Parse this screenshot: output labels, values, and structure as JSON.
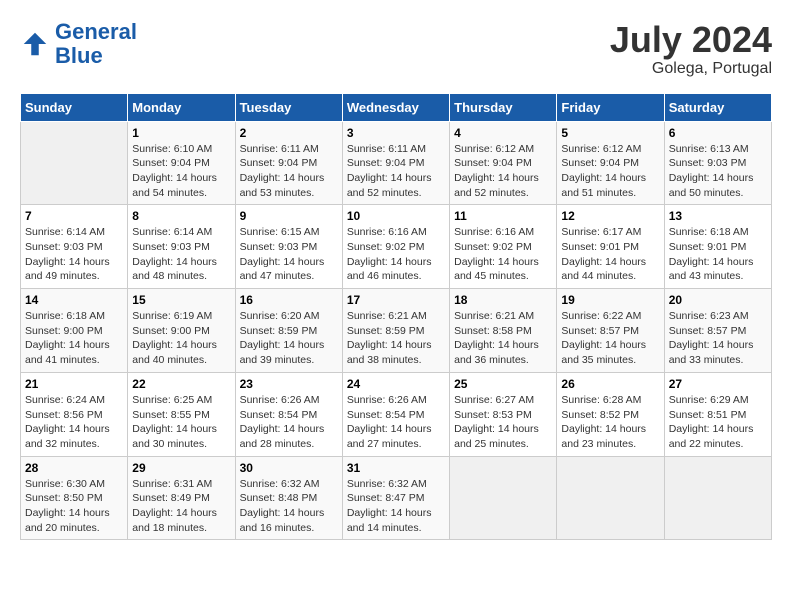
{
  "header": {
    "logo_line1": "General",
    "logo_line2": "Blue",
    "month": "July 2024",
    "location": "Golega, Portugal"
  },
  "days_of_week": [
    "Sunday",
    "Monday",
    "Tuesday",
    "Wednesday",
    "Thursday",
    "Friday",
    "Saturday"
  ],
  "weeks": [
    [
      {
        "day": "",
        "empty": true
      },
      {
        "day": "1",
        "sunrise": "Sunrise: 6:10 AM",
        "sunset": "Sunset: 9:04 PM",
        "daylight": "Daylight: 14 hours and 54 minutes."
      },
      {
        "day": "2",
        "sunrise": "Sunrise: 6:11 AM",
        "sunset": "Sunset: 9:04 PM",
        "daylight": "Daylight: 14 hours and 53 minutes."
      },
      {
        "day": "3",
        "sunrise": "Sunrise: 6:11 AM",
        "sunset": "Sunset: 9:04 PM",
        "daylight": "Daylight: 14 hours and 52 minutes."
      },
      {
        "day": "4",
        "sunrise": "Sunrise: 6:12 AM",
        "sunset": "Sunset: 9:04 PM",
        "daylight": "Daylight: 14 hours and 52 minutes."
      },
      {
        "day": "5",
        "sunrise": "Sunrise: 6:12 AM",
        "sunset": "Sunset: 9:04 PM",
        "daylight": "Daylight: 14 hours and 51 minutes."
      },
      {
        "day": "6",
        "sunrise": "Sunrise: 6:13 AM",
        "sunset": "Sunset: 9:03 PM",
        "daylight": "Daylight: 14 hours and 50 minutes."
      }
    ],
    [
      {
        "day": "7",
        "sunrise": "Sunrise: 6:14 AM",
        "sunset": "Sunset: 9:03 PM",
        "daylight": "Daylight: 14 hours and 49 minutes."
      },
      {
        "day": "8",
        "sunrise": "Sunrise: 6:14 AM",
        "sunset": "Sunset: 9:03 PM",
        "daylight": "Daylight: 14 hours and 48 minutes."
      },
      {
        "day": "9",
        "sunrise": "Sunrise: 6:15 AM",
        "sunset": "Sunset: 9:03 PM",
        "daylight": "Daylight: 14 hours and 47 minutes."
      },
      {
        "day": "10",
        "sunrise": "Sunrise: 6:16 AM",
        "sunset": "Sunset: 9:02 PM",
        "daylight": "Daylight: 14 hours and 46 minutes."
      },
      {
        "day": "11",
        "sunrise": "Sunrise: 6:16 AM",
        "sunset": "Sunset: 9:02 PM",
        "daylight": "Daylight: 14 hours and 45 minutes."
      },
      {
        "day": "12",
        "sunrise": "Sunrise: 6:17 AM",
        "sunset": "Sunset: 9:01 PM",
        "daylight": "Daylight: 14 hours and 44 minutes."
      },
      {
        "day": "13",
        "sunrise": "Sunrise: 6:18 AM",
        "sunset": "Sunset: 9:01 PM",
        "daylight": "Daylight: 14 hours and 43 minutes."
      }
    ],
    [
      {
        "day": "14",
        "sunrise": "Sunrise: 6:18 AM",
        "sunset": "Sunset: 9:00 PM",
        "daylight": "Daylight: 14 hours and 41 minutes."
      },
      {
        "day": "15",
        "sunrise": "Sunrise: 6:19 AM",
        "sunset": "Sunset: 9:00 PM",
        "daylight": "Daylight: 14 hours and 40 minutes."
      },
      {
        "day": "16",
        "sunrise": "Sunrise: 6:20 AM",
        "sunset": "Sunset: 8:59 PM",
        "daylight": "Daylight: 14 hours and 39 minutes."
      },
      {
        "day": "17",
        "sunrise": "Sunrise: 6:21 AM",
        "sunset": "Sunset: 8:59 PM",
        "daylight": "Daylight: 14 hours and 38 minutes."
      },
      {
        "day": "18",
        "sunrise": "Sunrise: 6:21 AM",
        "sunset": "Sunset: 8:58 PM",
        "daylight": "Daylight: 14 hours and 36 minutes."
      },
      {
        "day": "19",
        "sunrise": "Sunrise: 6:22 AM",
        "sunset": "Sunset: 8:57 PM",
        "daylight": "Daylight: 14 hours and 35 minutes."
      },
      {
        "day": "20",
        "sunrise": "Sunrise: 6:23 AM",
        "sunset": "Sunset: 8:57 PM",
        "daylight": "Daylight: 14 hours and 33 minutes."
      }
    ],
    [
      {
        "day": "21",
        "sunrise": "Sunrise: 6:24 AM",
        "sunset": "Sunset: 8:56 PM",
        "daylight": "Daylight: 14 hours and 32 minutes."
      },
      {
        "day": "22",
        "sunrise": "Sunrise: 6:25 AM",
        "sunset": "Sunset: 8:55 PM",
        "daylight": "Daylight: 14 hours and 30 minutes."
      },
      {
        "day": "23",
        "sunrise": "Sunrise: 6:26 AM",
        "sunset": "Sunset: 8:54 PM",
        "daylight": "Daylight: 14 hours and 28 minutes."
      },
      {
        "day": "24",
        "sunrise": "Sunrise: 6:26 AM",
        "sunset": "Sunset: 8:54 PM",
        "daylight": "Daylight: 14 hours and 27 minutes."
      },
      {
        "day": "25",
        "sunrise": "Sunrise: 6:27 AM",
        "sunset": "Sunset: 8:53 PM",
        "daylight": "Daylight: 14 hours and 25 minutes."
      },
      {
        "day": "26",
        "sunrise": "Sunrise: 6:28 AM",
        "sunset": "Sunset: 8:52 PM",
        "daylight": "Daylight: 14 hours and 23 minutes."
      },
      {
        "day": "27",
        "sunrise": "Sunrise: 6:29 AM",
        "sunset": "Sunset: 8:51 PM",
        "daylight": "Daylight: 14 hours and 22 minutes."
      }
    ],
    [
      {
        "day": "28",
        "sunrise": "Sunrise: 6:30 AM",
        "sunset": "Sunset: 8:50 PM",
        "daylight": "Daylight: 14 hours and 20 minutes."
      },
      {
        "day": "29",
        "sunrise": "Sunrise: 6:31 AM",
        "sunset": "Sunset: 8:49 PM",
        "daylight": "Daylight: 14 hours and 18 minutes."
      },
      {
        "day": "30",
        "sunrise": "Sunrise: 6:32 AM",
        "sunset": "Sunset: 8:48 PM",
        "daylight": "Daylight: 14 hours and 16 minutes."
      },
      {
        "day": "31",
        "sunrise": "Sunrise: 6:32 AM",
        "sunset": "Sunset: 8:47 PM",
        "daylight": "Daylight: 14 hours and 14 minutes."
      },
      {
        "day": "",
        "empty": true
      },
      {
        "day": "",
        "empty": true
      },
      {
        "day": "",
        "empty": true
      }
    ]
  ]
}
